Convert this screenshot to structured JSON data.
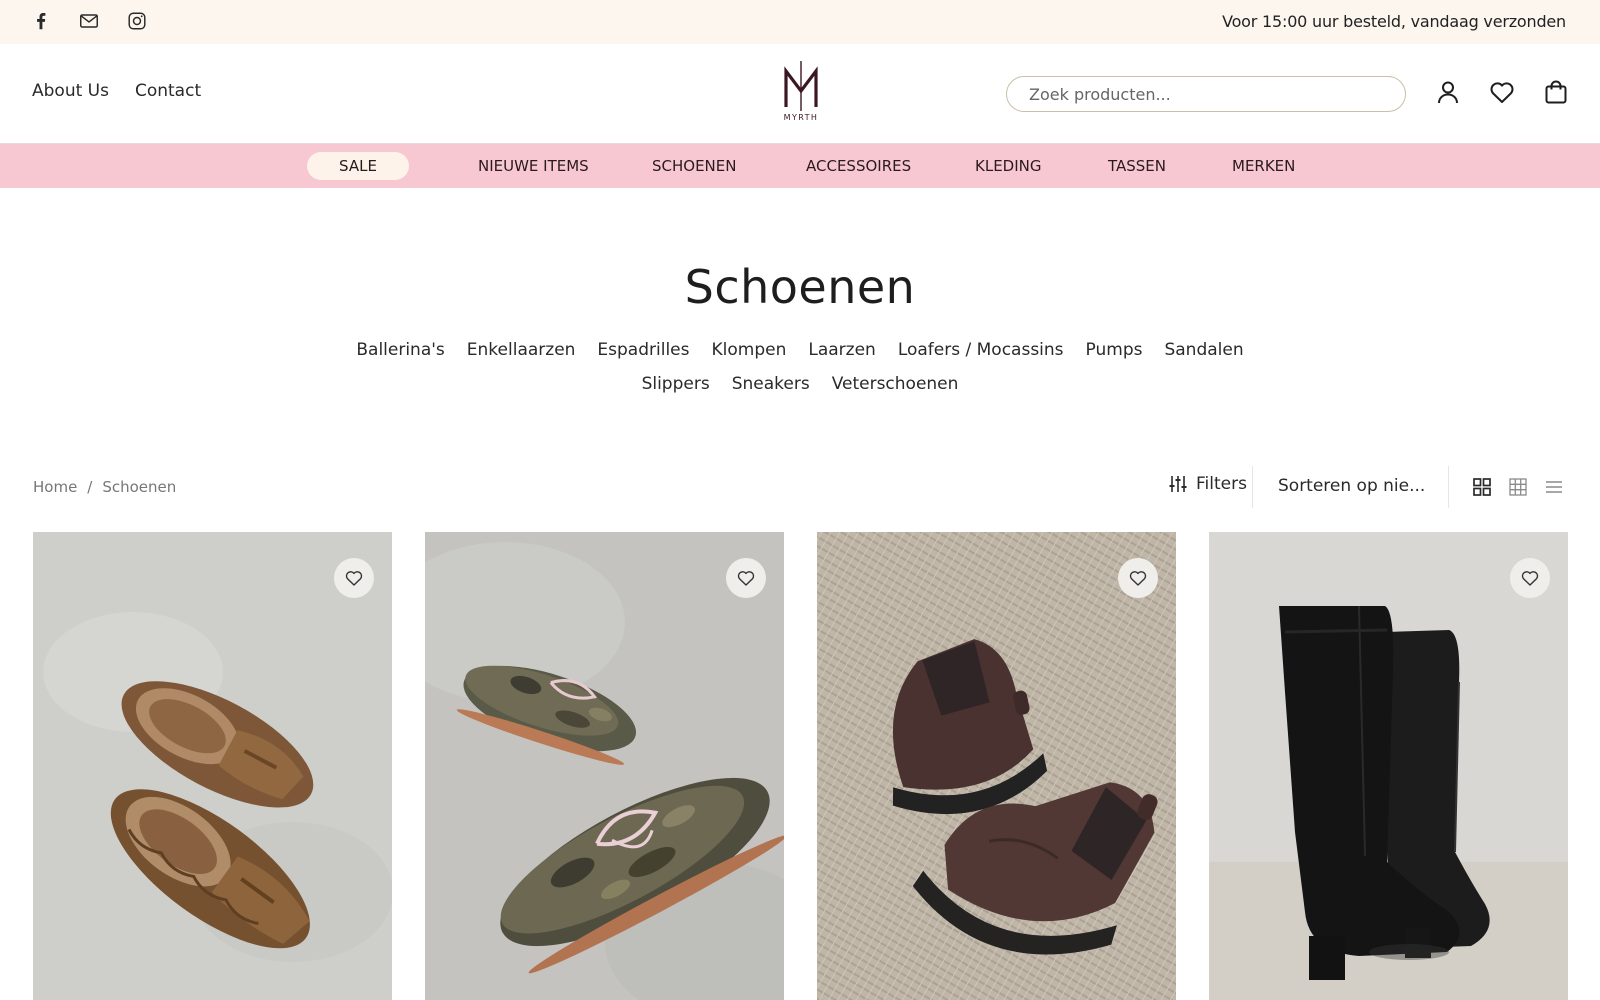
{
  "topbar": {
    "social_icons": [
      "facebook-icon",
      "mail-icon",
      "instagram-icon"
    ],
    "message": "Voor 15:00 uur besteld, vandaag verzonden"
  },
  "header": {
    "links": [
      {
        "label": "About Us"
      },
      {
        "label": "Contact"
      }
    ],
    "logo_text": "MYRTH",
    "search_placeholder": "Zoek producten...",
    "icons": [
      "account-icon",
      "wishlist-icon",
      "cart-icon"
    ]
  },
  "nav": {
    "items": [
      {
        "label": "Sale"
      },
      {
        "label": "Nieuwe items"
      },
      {
        "label": "Schoenen"
      },
      {
        "label": "Accessoires"
      },
      {
        "label": "Kleding"
      },
      {
        "label": "Tassen"
      },
      {
        "label": "Merken"
      }
    ]
  },
  "category": {
    "title": "Schoenen",
    "subcategories_row1": [
      "Ballerina's",
      "Enkellaarzen",
      "Espadrilles",
      "Klompen",
      "Laarzen",
      "Loafers / Mocassins",
      "Pumps",
      "Sandalen"
    ],
    "subcategories_row2": [
      "Slippers",
      "Sneakers",
      "Veterschoenen"
    ]
  },
  "toolbar": {
    "breadcrumb": [
      "Home",
      "/",
      "Schoenen"
    ],
    "filters_label": "Filters",
    "sort_label": "Sorteren op nie...",
    "view_icons": [
      "grid-2-icon",
      "grid-3-icon",
      "list-view-icon"
    ]
  },
  "products": [
    {
      "image": "brown-suede-shearling-loafer-mules",
      "wishlist_icon": "heart-icon"
    },
    {
      "image": "camo-print-fringed-boat-shoes",
      "wishlist_icon": "heart-icon"
    },
    {
      "image": "brown-suede-chelsea-boots",
      "wishlist_icon": "heart-icon"
    },
    {
      "image": "black-leather-knee-high-boots",
      "wishlist_icon": "heart-icon"
    }
  ],
  "colors": {
    "topbar_bg": "#fdf6ef",
    "nav_bg": "#f8c8d2",
    "sale_pill_bg": "#fdf3ea",
    "logo": "#3a1822"
  }
}
